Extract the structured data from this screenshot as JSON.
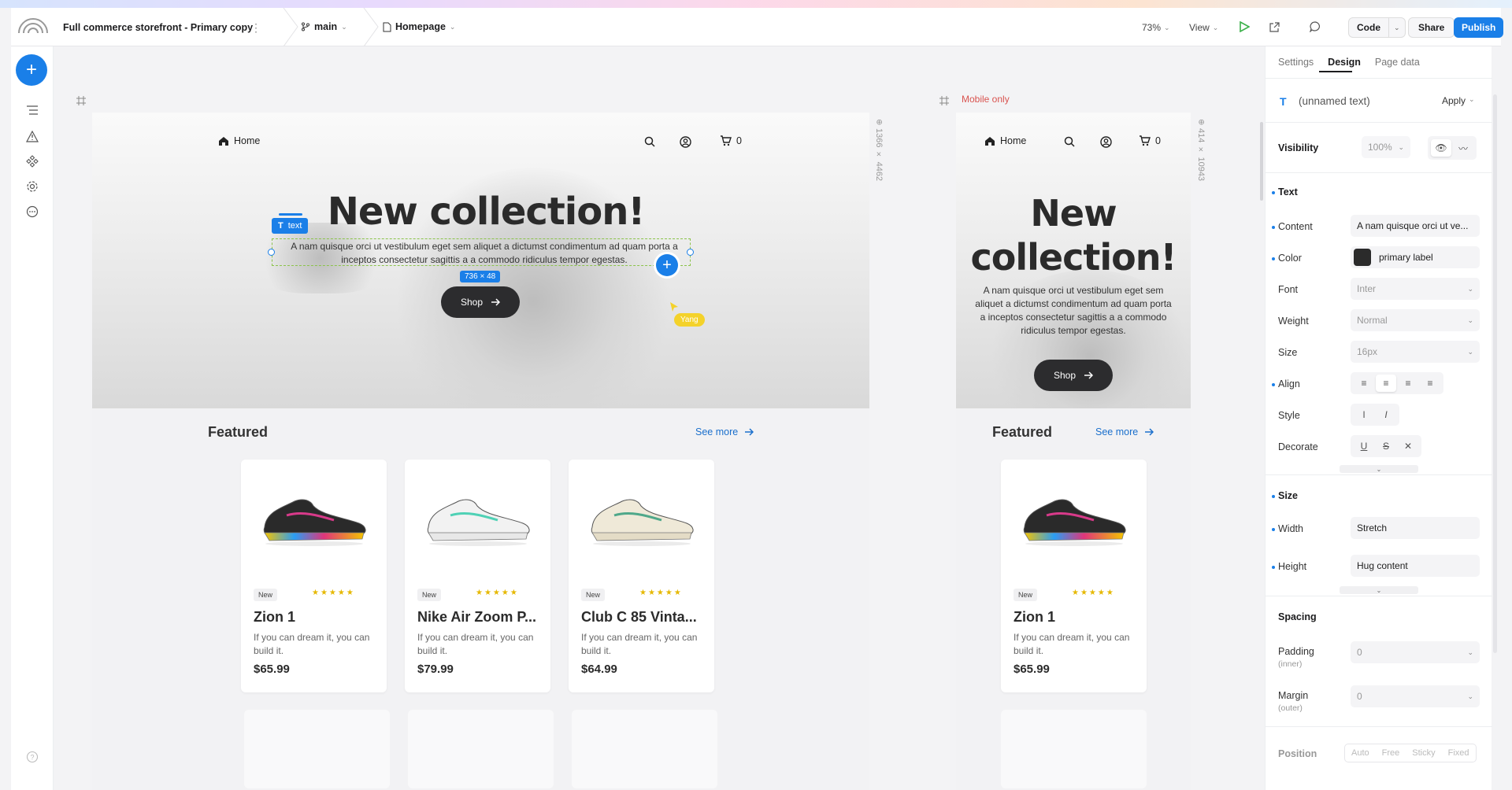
{
  "topbar": {
    "project_title": "Full commerce storefront - Primary copy",
    "branch": "main",
    "page": "Homepage",
    "zoom": "73%",
    "view_label": "View",
    "code_label": "Code",
    "share_label": "Share",
    "publish_label": "Publish"
  },
  "canvas": {
    "mobile_only_label": "Mobile only",
    "desktop_dims": "1366 × 4462",
    "mobile_dims": "414 × 10943",
    "selection_tag": "text",
    "selection_size": "736 × 48",
    "cursor_user": "Yang"
  },
  "site": {
    "nav_home": "Home",
    "cart_count": "0",
    "hero_title": "New collection!",
    "hero_title_mobile_1": "New",
    "hero_title_mobile_2": "collection!",
    "hero_paragraph_1": "A nam quisque orci ut vestibulum eget sem aliquet a dictumst condimentum ad quam porta a",
    "hero_paragraph_2": "inceptos consectetur sagittis a a commodo ridiculus tempor egestas.",
    "hero_paragraph_mobile": "A nam quisque orci ut vestibulum eget sem aliquet a dictumst condimentum ad quam porta a inceptos consectetur sagittis a a commodo ridiculus tempor egestas.",
    "shop_label": "Shop",
    "featured_title": "Featured",
    "see_more": "See more",
    "products": [
      {
        "badge": "New",
        "name": "Zion 1",
        "desc": "If you can dream it, you can build it.",
        "price": "$65.99",
        "color": "multi"
      },
      {
        "badge": "New",
        "name": "Nike Air Zoom P...",
        "desc": "If you can dream it, you can build it.",
        "price": "$79.99",
        "color": "white"
      },
      {
        "badge": "New",
        "name": "Club C 85 Vinta...",
        "desc": "If you can dream it, you can build it.",
        "price": "$64.99",
        "color": "cream"
      }
    ],
    "stars": "★★★★★"
  },
  "panel": {
    "tabs": [
      "Settings",
      "Design",
      "Page data"
    ],
    "active_tab": "Design",
    "element_name": "(unnamed text)",
    "apply_label": "Apply",
    "visibility_label": "Visibility",
    "visibility_value": "100%",
    "text_section": "Text",
    "content_label": "Content",
    "content_value": "A nam quisque orci ut ve...",
    "color_label": "Color",
    "color_value": "primary label",
    "font_label": "Font",
    "font_value": "Inter",
    "weight_label": "Weight",
    "weight_value": "Normal",
    "size_label": "Size",
    "size_value": "16px",
    "align_label": "Align",
    "style_label": "Style",
    "decorate_label": "Decorate",
    "size_section": "Size",
    "width_label": "Width",
    "width_value": "Stretch",
    "height_label": "Height",
    "height_value": "Hug content",
    "spacing_section": "Spacing",
    "padding_label": "Padding",
    "padding_sub": "(inner)",
    "padding_value": "0",
    "margin_label": "Margin",
    "margin_sub": "(outer)",
    "margin_value": "0",
    "position_section": "Position",
    "position_options": [
      "Auto",
      "Free",
      "Sticky",
      "Fixed"
    ]
  },
  "colors": {
    "accent": "#1a7fe8",
    "primary_label": "#2b2b2b",
    "cursor": "#f4d22a",
    "mobile_only": "#d9534f"
  }
}
